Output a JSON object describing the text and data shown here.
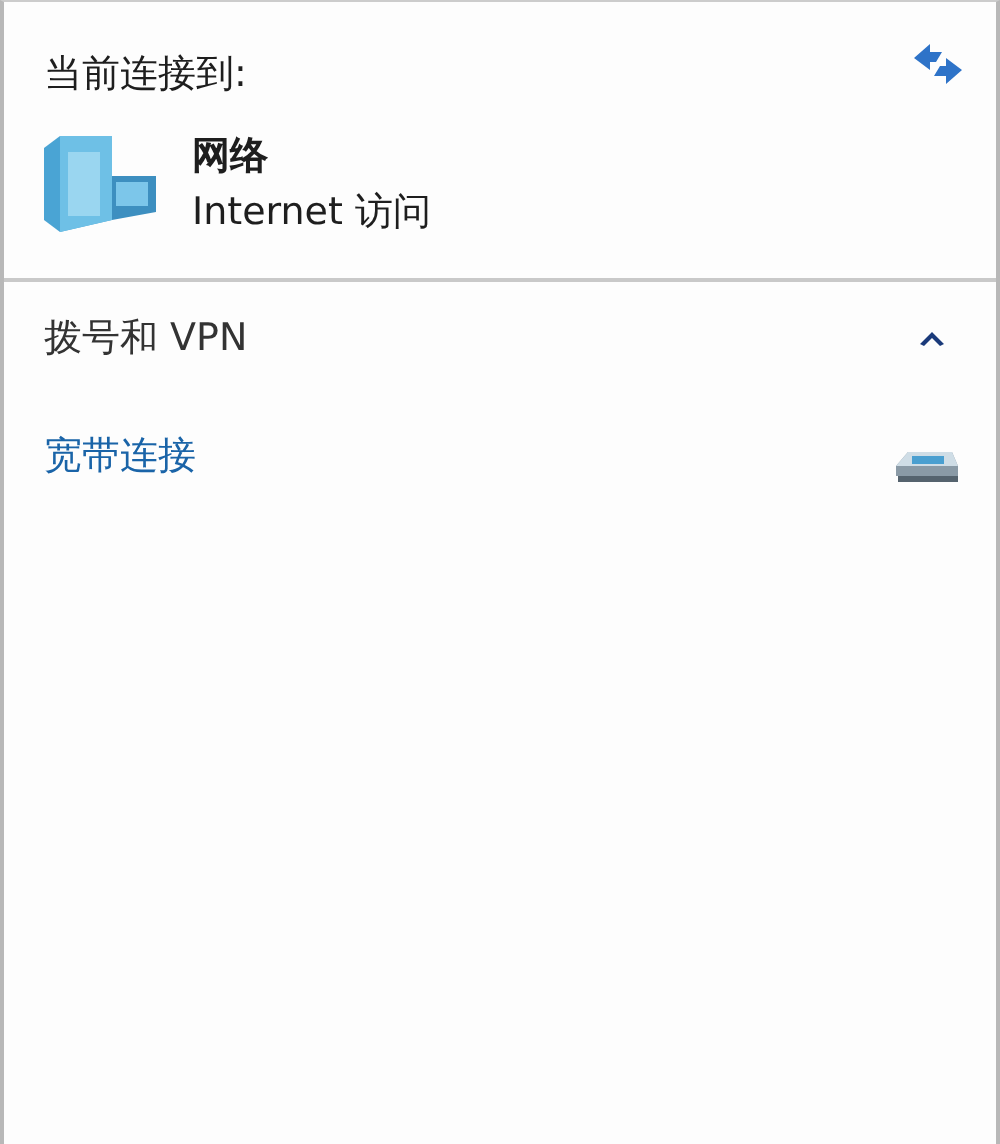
{
  "header": {
    "title": "当前连接到:"
  },
  "current_network": {
    "name": "网络",
    "access": "Internet 访问"
  },
  "section": {
    "title": "拨号和 VPN",
    "expanded": true,
    "items": [
      {
        "name": "宽带连接"
      }
    ]
  }
}
